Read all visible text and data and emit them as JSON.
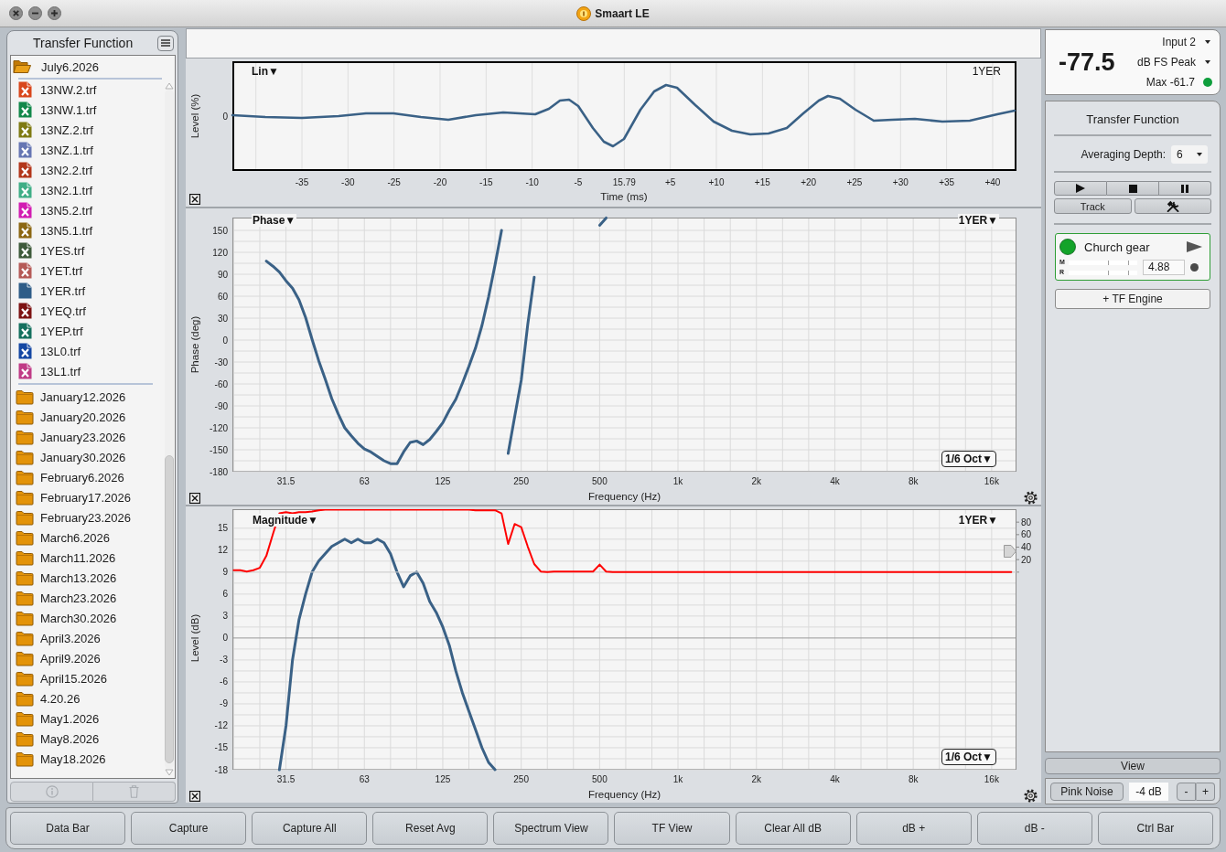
{
  "window": {
    "title": "Smaart LE"
  },
  "sidebar": {
    "title": "Transfer Function",
    "items": [
      {
        "label": "July6.2026",
        "expanded": true,
        "children": [
          {
            "label": "13NW.2.trf",
            "color": "#d9461b",
            "active": false
          },
          {
            "label": "13NW.1.trf",
            "color": "#12884a",
            "active": false
          },
          {
            "label": "13NZ.2.trf",
            "color": "#7f7a12",
            "active": false
          },
          {
            "label": "13NZ.1.trf",
            "color": "#6676b3",
            "active": false
          },
          {
            "label": "13N2.2.trf",
            "color": "#b3361a",
            "active": false
          },
          {
            "label": "13N2.1.trf",
            "color": "#3fae86",
            "active": false
          },
          {
            "label": "13N5.2.trf",
            "color": "#d21cb2",
            "active": false
          },
          {
            "label": "13N5.1.trf",
            "color": "#8c6712",
            "active": false
          },
          {
            "label": "1YES.trf",
            "color": "#3e5a3a",
            "active": false
          },
          {
            "label": "1YET.trf",
            "color": "#b55a57",
            "active": false
          },
          {
            "label": "1YER.trf",
            "color": "#2e5c87",
            "active": true
          },
          {
            "label": "1YEQ.trf",
            "color": "#7d1212",
            "active": false
          },
          {
            "label": "1YEP.trf",
            "color": "#14705e",
            "active": false
          },
          {
            "label": "13L0.trf",
            "color": "#1447a3",
            "active": false
          },
          {
            "label": "13L1.trf",
            "color": "#c03b86",
            "active": false
          }
        ]
      },
      {
        "label": "January12.2026",
        "expanded": false
      },
      {
        "label": "January20.2026",
        "expanded": false
      },
      {
        "label": "January23.2026",
        "expanded": false
      },
      {
        "label": "January30.2026",
        "expanded": false
      },
      {
        "label": "February6.2026",
        "expanded": false
      },
      {
        "label": "February17.2026",
        "expanded": false
      },
      {
        "label": "February23.2026",
        "expanded": false
      },
      {
        "label": "March6.2026",
        "expanded": false
      },
      {
        "label": "March11.2026",
        "expanded": false
      },
      {
        "label": "March13.2026",
        "expanded": false
      },
      {
        "label": "March23.2026",
        "expanded": false
      },
      {
        "label": "March30.2026",
        "expanded": false
      },
      {
        "label": "April3.2026",
        "expanded": false
      },
      {
        "label": "April9.2026",
        "expanded": false
      },
      {
        "label": "April15.2026",
        "expanded": false
      },
      {
        "label": "4.20.26",
        "expanded": false
      },
      {
        "label": "May1.2026",
        "expanded": false
      },
      {
        "label": "May8.2026",
        "expanded": false
      },
      {
        "label": "May18.2026",
        "expanded": false
      }
    ]
  },
  "impulse_plot": {
    "title": "Lin▼",
    "trace": "1YER",
    "ylabel": "Level (%)",
    "yticks": [
      "0"
    ],
    "xticks": [
      "-35",
      "-30",
      "-25",
      "-20",
      "-15",
      "-10",
      "-5",
      "15.79",
      "+5",
      "+10",
      "+15",
      "+20",
      "+25",
      "+30",
      "+35",
      "+40"
    ],
    "xlabel": "Time (ms)"
  },
  "phase_plot": {
    "title": "Phase▼",
    "trace": "1YER▼",
    "smoothing": "1/6 Oct▼",
    "chart_data": {
      "type": "line",
      "xlabel": "Frequency (Hz)",
      "ylabel": "Phase (deg)",
      "grid": true,
      "categories": [
        null,
        null,
        null,
        null,
        null,
        null,
        null,
        null,
        "31.5",
        null,
        null,
        null,
        null,
        null,
        null,
        null,
        null,
        null,
        null,
        null,
        "63",
        null,
        null,
        null,
        null,
        null,
        null,
        null,
        null,
        null,
        null,
        null,
        "125",
        null,
        null,
        null,
        null,
        null,
        null,
        null,
        null,
        null,
        null,
        null,
        "250",
        null,
        null,
        null,
        null,
        null,
        null,
        null,
        null,
        null,
        null,
        null,
        "500",
        null,
        null,
        null,
        null,
        null,
        null,
        null,
        null,
        null,
        null,
        null,
        "1k",
        null,
        null,
        null,
        null,
        null,
        null,
        null,
        null,
        null,
        null,
        null,
        "2k",
        null,
        null,
        null,
        null,
        null,
        null,
        null,
        null,
        null,
        null,
        null,
        "4k",
        null,
        null,
        null,
        null,
        null,
        null,
        null,
        null,
        null,
        null,
        null,
        "8k",
        null,
        null,
        null,
        null,
        null,
        null,
        null,
        null,
        null,
        null,
        null,
        "16k",
        null,
        null,
        null
      ],
      "series": [
        {
          "color": "#3a6186",
          "values": [
            null,
            null,
            null,
            null,
            null,
            108,
            101,
            93,
            81,
            71,
            55,
            31,
            1,
            -28,
            -53,
            -80,
            -101,
            -120,
            -131,
            -141,
            -149,
            -153,
            -159,
            -165,
            -169,
            -169,
            -153,
            -140,
            -138,
            -143,
            -136,
            -125,
            -113,
            -96,
            -81,
            -59,
            -36,
            -11,
            20,
            59,
            103,
            150,
            null,
            null,
            null,
            null,
            null,
            null,
            null,
            null,
            null,
            null,
            null,
            null,
            null,
            null,
            null,
            null,
            null,
            null,
            null,
            null,
            null,
            null,
            null,
            null,
            null,
            null,
            null,
            null,
            null,
            null,
            null,
            null,
            null,
            null,
            null,
            null,
            null,
            null,
            null,
            null,
            null,
            null,
            null,
            null,
            null,
            null,
            null,
            null,
            null,
            null,
            null,
            null,
            null,
            null,
            null,
            null,
            null,
            null,
            null,
            null,
            null,
            null,
            null,
            null,
            null,
            null,
            null,
            null,
            null,
            null,
            null,
            null,
            null,
            null,
            null,
            null,
            null,
            null
          ]
        },
        {
          "color": "#3a6186",
          "values": [
            null,
            null,
            null,
            null,
            null,
            null,
            null,
            null,
            null,
            null,
            null,
            null,
            null,
            null,
            null,
            null,
            null,
            null,
            null,
            null,
            null,
            null,
            null,
            null,
            null,
            null,
            null,
            null,
            null,
            null,
            null,
            null,
            null,
            null,
            null,
            null,
            null,
            null,
            null,
            null,
            null,
            null,
            -155,
            -105,
            -55,
            21,
            86,
            null,
            null,
            null,
            null,
            null,
            null,
            null,
            null,
            null,
            null,
            null,
            null,
            null,
            null,
            null,
            null,
            null,
            null,
            null,
            null,
            null,
            null,
            null,
            null,
            null,
            null,
            null,
            null,
            null,
            null,
            null,
            null,
            null,
            null,
            null,
            null,
            null,
            null,
            null,
            null,
            null,
            null,
            null,
            null,
            null,
            null,
            null,
            null,
            null,
            null,
            null,
            null,
            null,
            null,
            null,
            null,
            null,
            null,
            null,
            null,
            null,
            null,
            null,
            null,
            null,
            null,
            null,
            null,
            null,
            null,
            null,
            null,
            null
          ]
        },
        {
          "color": "#3a6186",
          "values": [
            null,
            null,
            null,
            null,
            null,
            null,
            null,
            null,
            null,
            null,
            null,
            null,
            null,
            null,
            null,
            null,
            null,
            null,
            null,
            null,
            null,
            null,
            null,
            null,
            null,
            null,
            null,
            null,
            null,
            null,
            null,
            null,
            null,
            null,
            null,
            null,
            null,
            null,
            null,
            null,
            null,
            null,
            null,
            null,
            null,
            null,
            null,
            null,
            null,
            null,
            null,
            null,
            null,
            null,
            null,
            null,
            157,
            167,
            null,
            null,
            null,
            null,
            null,
            null,
            null,
            null,
            null,
            null,
            null,
            null,
            null,
            null,
            null,
            null,
            null,
            null,
            null,
            null,
            null,
            null,
            null,
            null,
            null,
            null,
            null,
            null,
            null,
            null,
            null,
            null,
            null,
            null,
            null,
            null,
            null,
            null,
            null,
            null,
            null,
            null,
            null,
            null,
            null,
            null,
            null,
            null,
            null,
            null,
            null,
            null,
            null,
            null,
            null,
            null,
            null,
            null,
            null,
            null,
            null,
            null
          ]
        }
      ],
      "ylim": [
        -180,
        167.5
      ],
      "yticks": [
        150,
        120,
        90,
        60,
        30,
        0,
        -30,
        -60,
        -90,
        -120,
        -150,
        -180
      ]
    }
  },
  "magnitude_plot": {
    "title": "Magnitude▼",
    "trace": "1YER▼",
    "smoothing": "1/6 Oct▼",
    "chart_data": {
      "type": "line",
      "xlabel": "Frequency (Hz)",
      "ylabel": "Level (dB)",
      "grid": true,
      "categories": [
        null,
        null,
        null,
        null,
        null,
        null,
        null,
        null,
        "31.5",
        null,
        null,
        null,
        null,
        null,
        null,
        null,
        null,
        null,
        null,
        null,
        "63",
        null,
        null,
        null,
        null,
        null,
        null,
        null,
        null,
        null,
        null,
        null,
        "125",
        null,
        null,
        null,
        null,
        null,
        null,
        null,
        null,
        null,
        null,
        null,
        "250",
        null,
        null,
        null,
        null,
        null,
        null,
        null,
        null,
        null,
        null,
        null,
        "500",
        null,
        null,
        null,
        null,
        null,
        null,
        null,
        null,
        null,
        null,
        null,
        "1k",
        null,
        null,
        null,
        null,
        null,
        null,
        null,
        null,
        null,
        null,
        null,
        "2k",
        null,
        null,
        null,
        null,
        null,
        null,
        null,
        null,
        null,
        null,
        null,
        "4k",
        null,
        null,
        null,
        null,
        null,
        null,
        null,
        null,
        null,
        null,
        null,
        "8k",
        null,
        null,
        null,
        null,
        null,
        null,
        null,
        null,
        null,
        null,
        null,
        "16k",
        null,
        null,
        null
      ],
      "series": [
        {
          "color": "#3a6186",
          "values": [
            null,
            null,
            null,
            null,
            null,
            null,
            null,
            -18,
            -12,
            -3,
            2.5,
            6,
            9,
            10.5,
            11.5,
            12.5,
            13,
            13.5,
            13,
            13.5,
            13,
            13,
            13.5,
            13,
            11.5,
            9,
            7,
            8.5,
            9,
            7.5,
            5,
            3.5,
            1.5,
            -1,
            -4.5,
            -7.5,
            -10,
            -12.5,
            -15,
            -17,
            -18,
            null,
            null,
            null,
            null,
            null,
            null,
            null,
            null,
            null,
            null,
            null,
            null,
            null,
            null,
            null,
            null,
            null,
            null,
            null,
            null,
            null,
            null,
            null,
            null,
            null,
            null,
            null,
            null,
            null,
            null,
            null,
            null,
            null,
            null,
            null,
            null,
            null,
            null,
            null,
            null,
            null,
            null,
            null,
            null,
            null,
            null,
            null,
            null,
            null,
            null,
            null,
            null,
            null,
            null,
            null,
            null,
            null,
            null,
            null,
            null,
            null,
            null,
            null,
            null,
            null,
            null,
            null,
            null,
            null,
            null,
            null,
            null,
            null,
            null,
            null,
            null,
            null,
            null,
            null
          ]
        }
      ],
      "ylim": [
        -18,
        17.6
      ],
      "yticks": [
        15,
        12,
        9,
        6,
        3,
        0,
        -3,
        -6,
        -9,
        -12,
        -15,
        -18
      ]
    },
    "coherence": {
      "chart_data": {
        "type": "line",
        "categories": [
          null,
          null,
          null,
          null,
          null,
          null,
          null,
          null,
          null,
          null,
          null,
          null,
          null,
          null,
          null,
          null,
          null,
          null,
          null,
          null,
          null,
          null,
          null,
          null,
          null,
          null,
          null,
          null,
          null,
          null,
          null,
          null,
          null,
          null,
          null,
          null,
          null,
          null,
          null,
          null,
          null,
          null,
          null,
          null,
          null,
          null,
          null,
          null,
          null,
          null,
          null,
          null,
          null,
          null,
          null,
          null,
          null,
          null,
          null,
          null,
          null,
          null,
          null,
          null,
          null,
          null,
          null,
          null,
          null,
          null,
          null,
          null,
          null,
          null,
          null,
          null,
          null,
          null,
          null,
          null,
          null,
          null,
          null,
          null,
          null,
          null,
          null,
          null,
          null,
          null,
          null,
          null,
          null,
          null,
          null,
          null,
          null,
          null,
          null,
          null,
          null,
          null,
          null,
          null,
          null,
          null,
          null,
          null,
          null,
          null,
          null,
          null,
          null,
          null,
          null,
          null,
          null,
          null,
          null,
          null
        ],
        "series": [
          {
            "color": "#ff0000",
            "values": [
              3,
              3,
              1,
              3,
              7,
              26,
              61,
              94,
              96,
              94,
              96,
              96,
              97,
              99,
              100,
              100,
              100,
              100,
              100,
              100,
              100,
              100,
              100,
              100,
              100,
              100,
              100,
              100,
              100,
              100,
              100,
              100,
              100,
              100,
              100,
              100,
              100,
              99,
              99,
              99,
              99,
              94,
              45,
              77,
              72,
              41,
              13,
              1,
              0,
              1,
              1,
              1,
              1,
              1,
              1,
              1,
              12,
              1,
              0,
              0,
              0,
              0,
              0,
              0,
              0,
              0,
              0,
              0,
              0,
              0,
              0,
              0,
              0,
              0,
              0,
              0,
              0,
              0,
              0,
              0,
              0,
              0,
              0,
              0,
              0,
              0,
              0,
              0,
              0,
              0,
              0,
              0,
              0,
              0,
              0,
              0,
              0,
              0,
              0,
              0,
              0,
              0,
              0,
              0,
              0,
              0,
              0,
              0,
              0,
              0,
              0,
              0,
              0,
              0,
              0,
              0,
              0,
              0,
              0,
              0
            ]
          }
        ],
        "ylim": [
          0,
          100
        ],
        "yticks": [
          80,
          60,
          40,
          20
        ]
      }
    }
  },
  "meter": {
    "value": "-77.5",
    "input": "Input 2",
    "scale": "dB FS Peak",
    "max": "Max -61.7",
    "signal_ok": true
  },
  "tf_panel": {
    "title": "Transfer Function",
    "averaging_label": "Averaging Depth:",
    "averaging_value": "6",
    "track_button": "Track",
    "engine": {
      "name": "Church gear",
      "on": true,
      "meters": [
        {
          "label": "M"
        },
        {
          "label": "R"
        }
      ],
      "delay": "4.88",
      "indicator_on": false
    },
    "add_button": "+ TF Engine"
  },
  "view_button": "View",
  "generator": {
    "button": "Pink Noise",
    "level": "-4 dB",
    "minus": "-",
    "plus": "+"
  },
  "toolbar": [
    "Data Bar",
    "Capture",
    "Capture All",
    "Reset Avg",
    "Spectrum View",
    "TF View",
    "Clear All dB",
    "dB +",
    "dB -",
    "Ctrl Bar"
  ]
}
